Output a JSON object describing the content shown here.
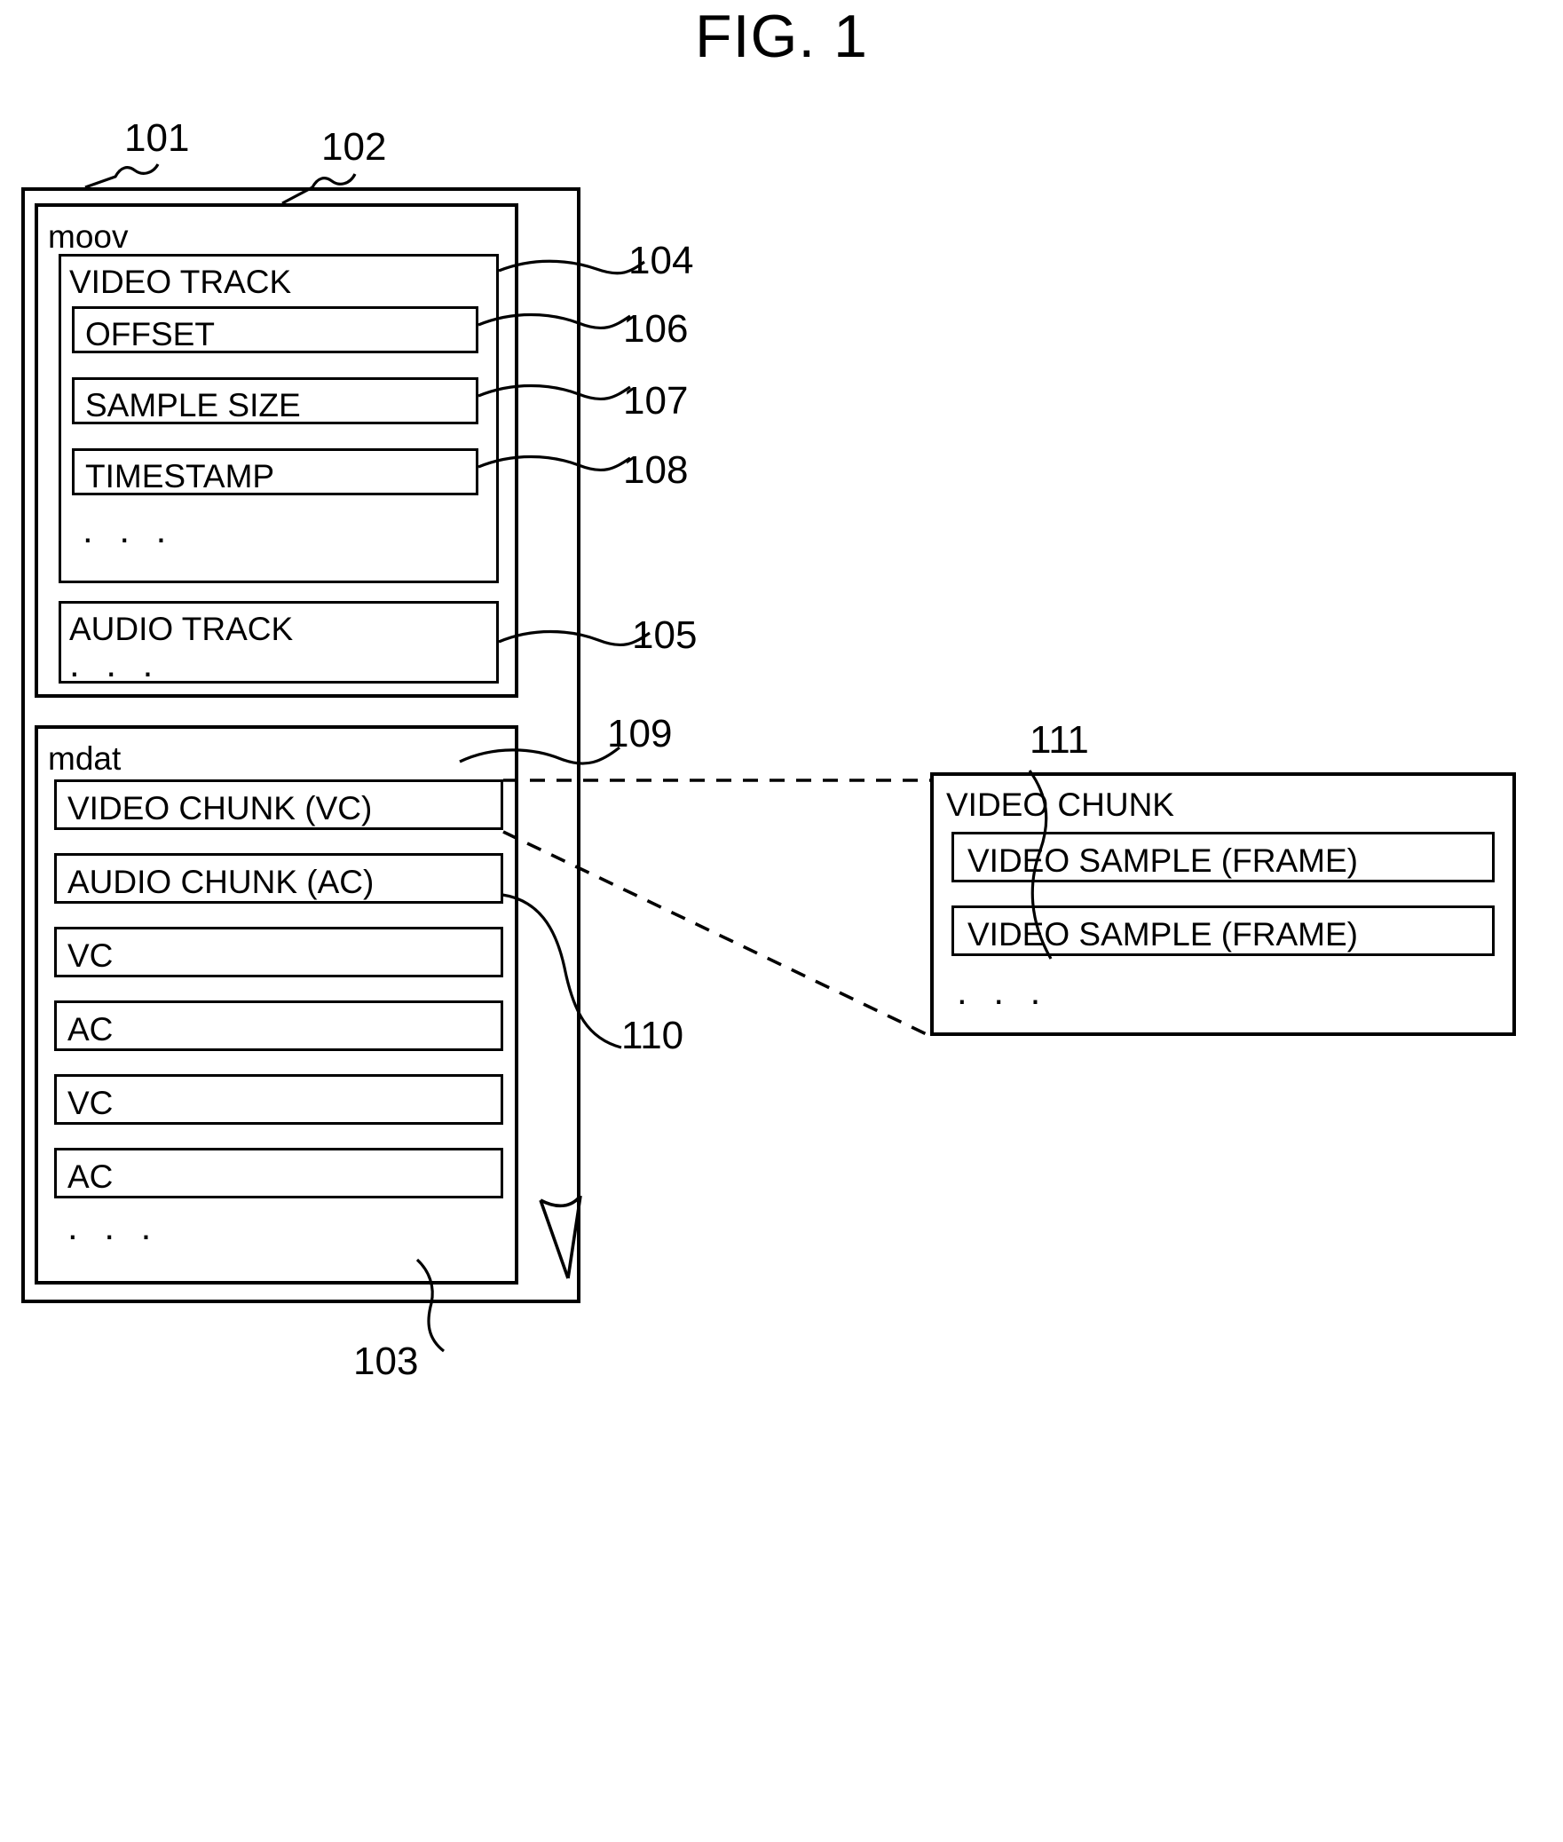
{
  "figure": {
    "title": "FIG. 1"
  },
  "refs": {
    "r101": "101",
    "r102": "102",
    "r103": "103",
    "r104": "104",
    "r105": "105",
    "r106": "106",
    "r107": "107",
    "r108": "108",
    "r109": "109",
    "r110": "110",
    "r111": "111"
  },
  "file_container": {
    "name": "media-file-container",
    "moov_box": {
      "label": "moov",
      "video_track": {
        "label": "VIDEO TRACK",
        "fields": [
          {
            "label": "OFFSET"
          },
          {
            "label": "SAMPLE SIZE"
          },
          {
            "label": "TIMESTAMP"
          }
        ],
        "ellipsis": ". . ."
      },
      "audio_track": {
        "label": "AUDIO TRACK",
        "ellipsis": ". . ."
      }
    },
    "mdat_box": {
      "label": "mdat",
      "chunks": [
        {
          "label": "VIDEO CHUNK (VC)"
        },
        {
          "label": "AUDIO CHUNK (AC)"
        },
        {
          "label": "VC"
        },
        {
          "label": "AC"
        },
        {
          "label": "VC"
        },
        {
          "label": "AC"
        }
      ],
      "ellipsis": ". . ."
    }
  },
  "detail_panel": {
    "label": "VIDEO CHUNK",
    "samples": [
      {
        "label": "VIDEO SAMPLE (FRAME)"
      },
      {
        "label": "VIDEO SAMPLE (FRAME)"
      }
    ],
    "ellipsis": ". . ."
  },
  "colors": {
    "ink": "#000000",
    "paper": "#ffffff"
  }
}
